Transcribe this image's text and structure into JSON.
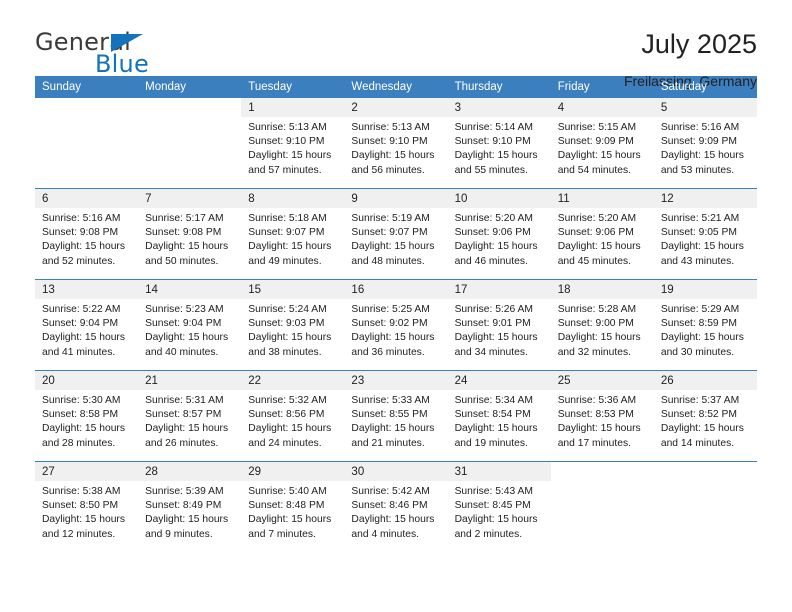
{
  "brand": {
    "name_top": "General",
    "name_bottom": "Blue",
    "triangle_color": "#1573bb"
  },
  "header": {
    "title": "July 2025",
    "subtitle": "Freilassing, Germany"
  },
  "theme": {
    "header_blue": "#3c7fbe",
    "daynum_bg": "#f0f0f0",
    "text": "#222222"
  },
  "weekday_headers": [
    "Sunday",
    "Monday",
    "Tuesday",
    "Wednesday",
    "Thursday",
    "Friday",
    "Saturday"
  ],
  "weeks": [
    [
      {
        "day": "",
        "sunrise": "",
        "sunset": "",
        "daylight_1": "",
        "daylight_2": ""
      },
      {
        "day": "",
        "sunrise": "",
        "sunset": "",
        "daylight_1": "",
        "daylight_2": ""
      },
      {
        "day": "1",
        "sunrise": "Sunrise: 5:13 AM",
        "sunset": "Sunset: 9:10 PM",
        "daylight_1": "Daylight: 15 hours",
        "daylight_2": "and 57 minutes."
      },
      {
        "day": "2",
        "sunrise": "Sunrise: 5:13 AM",
        "sunset": "Sunset: 9:10 PM",
        "daylight_1": "Daylight: 15 hours",
        "daylight_2": "and 56 minutes."
      },
      {
        "day": "3",
        "sunrise": "Sunrise: 5:14 AM",
        "sunset": "Sunset: 9:10 PM",
        "daylight_1": "Daylight: 15 hours",
        "daylight_2": "and 55 minutes."
      },
      {
        "day": "4",
        "sunrise": "Sunrise: 5:15 AM",
        "sunset": "Sunset: 9:09 PM",
        "daylight_1": "Daylight: 15 hours",
        "daylight_2": "and 54 minutes."
      },
      {
        "day": "5",
        "sunrise": "Sunrise: 5:16 AM",
        "sunset": "Sunset: 9:09 PM",
        "daylight_1": "Daylight: 15 hours",
        "daylight_2": "and 53 minutes."
      }
    ],
    [
      {
        "day": "6",
        "sunrise": "Sunrise: 5:16 AM",
        "sunset": "Sunset: 9:08 PM",
        "daylight_1": "Daylight: 15 hours",
        "daylight_2": "and 52 minutes."
      },
      {
        "day": "7",
        "sunrise": "Sunrise: 5:17 AM",
        "sunset": "Sunset: 9:08 PM",
        "daylight_1": "Daylight: 15 hours",
        "daylight_2": "and 50 minutes."
      },
      {
        "day": "8",
        "sunrise": "Sunrise: 5:18 AM",
        "sunset": "Sunset: 9:07 PM",
        "daylight_1": "Daylight: 15 hours",
        "daylight_2": "and 49 minutes."
      },
      {
        "day": "9",
        "sunrise": "Sunrise: 5:19 AM",
        "sunset": "Sunset: 9:07 PM",
        "daylight_1": "Daylight: 15 hours",
        "daylight_2": "and 48 minutes."
      },
      {
        "day": "10",
        "sunrise": "Sunrise: 5:20 AM",
        "sunset": "Sunset: 9:06 PM",
        "daylight_1": "Daylight: 15 hours",
        "daylight_2": "and 46 minutes."
      },
      {
        "day": "11",
        "sunrise": "Sunrise: 5:20 AM",
        "sunset": "Sunset: 9:06 PM",
        "daylight_1": "Daylight: 15 hours",
        "daylight_2": "and 45 minutes."
      },
      {
        "day": "12",
        "sunrise": "Sunrise: 5:21 AM",
        "sunset": "Sunset: 9:05 PM",
        "daylight_1": "Daylight: 15 hours",
        "daylight_2": "and 43 minutes."
      }
    ],
    [
      {
        "day": "13",
        "sunrise": "Sunrise: 5:22 AM",
        "sunset": "Sunset: 9:04 PM",
        "daylight_1": "Daylight: 15 hours",
        "daylight_2": "and 41 minutes."
      },
      {
        "day": "14",
        "sunrise": "Sunrise: 5:23 AM",
        "sunset": "Sunset: 9:04 PM",
        "daylight_1": "Daylight: 15 hours",
        "daylight_2": "and 40 minutes."
      },
      {
        "day": "15",
        "sunrise": "Sunrise: 5:24 AM",
        "sunset": "Sunset: 9:03 PM",
        "daylight_1": "Daylight: 15 hours",
        "daylight_2": "and 38 minutes."
      },
      {
        "day": "16",
        "sunrise": "Sunrise: 5:25 AM",
        "sunset": "Sunset: 9:02 PM",
        "daylight_1": "Daylight: 15 hours",
        "daylight_2": "and 36 minutes."
      },
      {
        "day": "17",
        "sunrise": "Sunrise: 5:26 AM",
        "sunset": "Sunset: 9:01 PM",
        "daylight_1": "Daylight: 15 hours",
        "daylight_2": "and 34 minutes."
      },
      {
        "day": "18",
        "sunrise": "Sunrise: 5:28 AM",
        "sunset": "Sunset: 9:00 PM",
        "daylight_1": "Daylight: 15 hours",
        "daylight_2": "and 32 minutes."
      },
      {
        "day": "19",
        "sunrise": "Sunrise: 5:29 AM",
        "sunset": "Sunset: 8:59 PM",
        "daylight_1": "Daylight: 15 hours",
        "daylight_2": "and 30 minutes."
      }
    ],
    [
      {
        "day": "20",
        "sunrise": "Sunrise: 5:30 AM",
        "sunset": "Sunset: 8:58 PM",
        "daylight_1": "Daylight: 15 hours",
        "daylight_2": "and 28 minutes."
      },
      {
        "day": "21",
        "sunrise": "Sunrise: 5:31 AM",
        "sunset": "Sunset: 8:57 PM",
        "daylight_1": "Daylight: 15 hours",
        "daylight_2": "and 26 minutes."
      },
      {
        "day": "22",
        "sunrise": "Sunrise: 5:32 AM",
        "sunset": "Sunset: 8:56 PM",
        "daylight_1": "Daylight: 15 hours",
        "daylight_2": "and 24 minutes."
      },
      {
        "day": "23",
        "sunrise": "Sunrise: 5:33 AM",
        "sunset": "Sunset: 8:55 PM",
        "daylight_1": "Daylight: 15 hours",
        "daylight_2": "and 21 minutes."
      },
      {
        "day": "24",
        "sunrise": "Sunrise: 5:34 AM",
        "sunset": "Sunset: 8:54 PM",
        "daylight_1": "Daylight: 15 hours",
        "daylight_2": "and 19 minutes."
      },
      {
        "day": "25",
        "sunrise": "Sunrise: 5:36 AM",
        "sunset": "Sunset: 8:53 PM",
        "daylight_1": "Daylight: 15 hours",
        "daylight_2": "and 17 minutes."
      },
      {
        "day": "26",
        "sunrise": "Sunrise: 5:37 AM",
        "sunset": "Sunset: 8:52 PM",
        "daylight_1": "Daylight: 15 hours",
        "daylight_2": "and 14 minutes."
      }
    ],
    [
      {
        "day": "27",
        "sunrise": "Sunrise: 5:38 AM",
        "sunset": "Sunset: 8:50 PM",
        "daylight_1": "Daylight: 15 hours",
        "daylight_2": "and 12 minutes."
      },
      {
        "day": "28",
        "sunrise": "Sunrise: 5:39 AM",
        "sunset": "Sunset: 8:49 PM",
        "daylight_1": "Daylight: 15 hours",
        "daylight_2": "and 9 minutes."
      },
      {
        "day": "29",
        "sunrise": "Sunrise: 5:40 AM",
        "sunset": "Sunset: 8:48 PM",
        "daylight_1": "Daylight: 15 hours",
        "daylight_2": "and 7 minutes."
      },
      {
        "day": "30",
        "sunrise": "Sunrise: 5:42 AM",
        "sunset": "Sunset: 8:46 PM",
        "daylight_1": "Daylight: 15 hours",
        "daylight_2": "and 4 minutes."
      },
      {
        "day": "31",
        "sunrise": "Sunrise: 5:43 AM",
        "sunset": "Sunset: 8:45 PM",
        "daylight_1": "Daylight: 15 hours",
        "daylight_2": "and 2 minutes."
      },
      {
        "day": "",
        "sunrise": "",
        "sunset": "",
        "daylight_1": "",
        "daylight_2": ""
      },
      {
        "day": "",
        "sunrise": "",
        "sunset": "",
        "daylight_1": "",
        "daylight_2": ""
      }
    ]
  ]
}
